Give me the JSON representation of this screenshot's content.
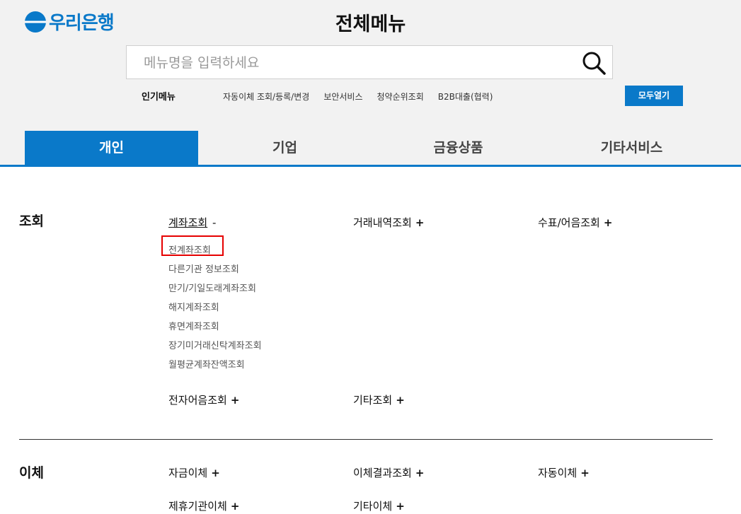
{
  "header": {
    "logo_text": "우리은행",
    "title": "전체메뉴",
    "search_placeholder": "메뉴명을 입력하세요",
    "popular_title": "인기메뉴",
    "popular_links": [
      "자동이체 조회/등록/변경",
      "보안서비스",
      "청약순위조회",
      "B2B대출(협력)"
    ],
    "open_all_label": "모두열기"
  },
  "tabs": [
    "개인",
    "기업",
    "금융상품",
    "기타서비스"
  ],
  "active_tab": "개인",
  "sections": {
    "inquiry": {
      "title": "조회",
      "cat_account": "계좌조회",
      "cat_account_toggle": "-",
      "subitems": [
        "전계좌조회",
        "다른기관 정보조회",
        "만기/기일도래계좌조회",
        "해지계좌조회",
        "휴면계좌조회",
        "장기미거래신탁계좌조회",
        "월평균계좌잔액조회"
      ],
      "cat_history": "거래내역조회",
      "cat_check": "수표/어음조회",
      "cat_e_bill": "전자어음조회",
      "cat_other": "기타조회"
    },
    "transfer": {
      "title": "이체",
      "cat_fund": "자금이체",
      "cat_result": "이체결과조회",
      "cat_auto": "자동이체",
      "cat_partner": "제휴기관이체",
      "cat_other": "기타이체"
    },
    "plus": "+"
  },
  "colors": {
    "brand": "#0a79c9",
    "highlight": "#e60000"
  }
}
